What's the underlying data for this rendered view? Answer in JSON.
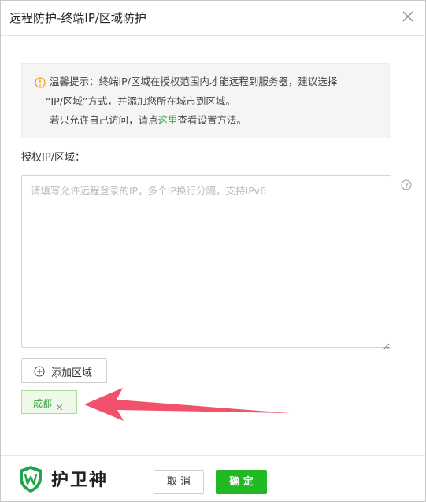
{
  "dialog": {
    "title": "远程防护-终端IP/区域防护",
    "close_icon": "close-icon"
  },
  "notice": {
    "icon": "warning-circle-icon",
    "line1": "温馨提示：终端IP/区域在授权范围内才能远程到服务器，建议选择",
    "line2": "“IP/区域”方式，并添加您所在城市到区域。",
    "line3_prefix": "若只允许自己访问，请点",
    "line3_link": "这里",
    "line3_suffix": "查看设置方法。"
  },
  "auth": {
    "label": "授权IP/区域：",
    "value": "",
    "placeholder": "请填写允许远程登录的IP，多个IP换行分隔，支持IPv6",
    "help_icon": "question-circle-icon"
  },
  "add_region": {
    "icon": "plus-circle-icon",
    "label": "添加区域"
  },
  "regions": [
    {
      "label": "成都",
      "remove_icon": "close-icon"
    }
  ],
  "annotation": {
    "icon": "red-arrow-icon"
  },
  "footer": {
    "logo_icon": "shield-w-icon",
    "brand": "护卫神",
    "cancel_label": "取 消",
    "confirm_label": "确 定"
  },
  "colors": {
    "primary_green": "#20b823",
    "link_green": "#31b03a",
    "tag_bg": "#eef9ea",
    "warning_orange": "#f0a020",
    "arrow_red": "#f2516b"
  }
}
